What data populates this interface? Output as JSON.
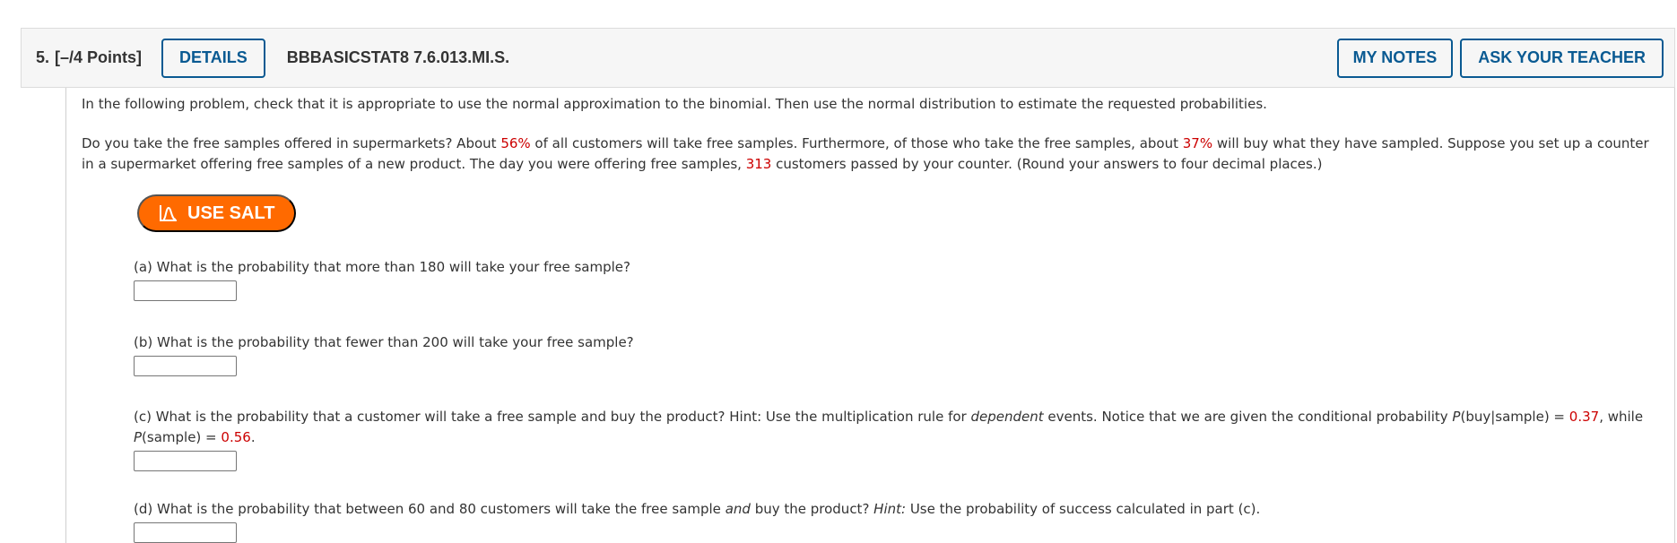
{
  "header": {
    "number": "5.",
    "points": "[–/4 Points]",
    "details_label": "DETAILS",
    "code": "BBBASICSTAT8 7.6.013.MI.S.",
    "my_notes_label": "MY NOTES",
    "ask_teacher_label": "ASK YOUR TEACHER"
  },
  "body": {
    "intro": "In the following problem, check that it is appropriate to use the normal approximation to the binomial. Then use the normal distribution to estimate the requested probabilities.",
    "problem": {
      "t1": "Do you take the free samples offered in supermarkets? About ",
      "v1": "56%",
      "t2": " of all customers will take free samples. Furthermore, of those who take the free samples, about ",
      "v2": "37%",
      "t3": " will buy what they have sampled. Suppose you set up a counter in a supermarket offering free samples of a new product. The day you were offering free samples, ",
      "v3": "313",
      "t4": " customers passed by your counter. (Round your answers to four decimal places.)"
    },
    "salt_label": "USE SALT",
    "parts": {
      "a": {
        "text": "(a) What is the probability that more than 180 will take your free sample?",
        "value": ""
      },
      "b": {
        "text": "(b) What is the probability that fewer than 200 will take your free sample?",
        "value": ""
      },
      "c": {
        "t1": "(c) What is the probability that a customer will take a free sample and buy the product? Hint: Use the multiplication rule for ",
        "em1": "dependent",
        "t2": " events. Notice that we are given the conditional probability ",
        "p1": "P",
        "t3": "(buy|sample) = ",
        "v1": "0.37",
        "t4": ", while ",
        "p2": "P",
        "t5": "(sample) = ",
        "v2": "0.56",
        "t6": ".",
        "value": ""
      },
      "d": {
        "t1": "(d) What is the probability that between 60 and 80 customers will take the free sample ",
        "em1": "and",
        "t2": " buy the product? ",
        "em2": "Hint:",
        "t3": " Use the probability of success calculated in part (c).",
        "value": ""
      }
    }
  },
  "colors": {
    "accent_blue": "#0a5a92",
    "salt_orange": "#ff6a00",
    "value_red": "#cc0000"
  }
}
